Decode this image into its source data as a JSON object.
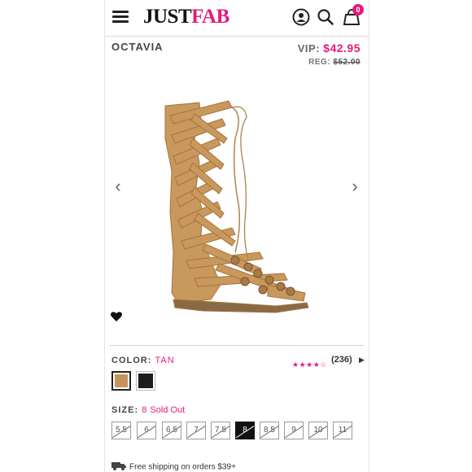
{
  "header": {
    "logo_part1": "JUST",
    "logo_part2": "FAB",
    "bag_count": "0",
    "icons": [
      "menu-icon",
      "account-icon",
      "search-icon",
      "bag-icon"
    ],
    "brand_color": "#e8197a"
  },
  "product": {
    "name": "OCTAVIA",
    "vip_label": "VIP:",
    "vip_price": "$42.95",
    "reg_label": "REG:",
    "reg_price": "$52.00"
  },
  "gallery": {
    "prev_icon": "chevron-left-icon",
    "next_icon": "chevron-right-icon",
    "favorite_icon": "heart-icon"
  },
  "color": {
    "label": "COLOR:",
    "value": "TAN",
    "swatches": [
      {
        "name": "tan",
        "hex": "#c8935a",
        "selected": true
      },
      {
        "name": "black",
        "hex": "#1c1c1c",
        "selected": false
      }
    ]
  },
  "rating": {
    "stars": "★★★★☆",
    "count": "(236)",
    "value": 4,
    "max": 5
  },
  "size": {
    "label": "SIZE:",
    "value": "8",
    "status": "Sold Out",
    "options": [
      "5.5",
      "6",
      "6.5",
      "7",
      "7.5",
      "8",
      "8.5",
      "9",
      "10",
      "11"
    ],
    "selected": "8"
  },
  "shipping": {
    "text": "Free shipping on orders $39+"
  }
}
